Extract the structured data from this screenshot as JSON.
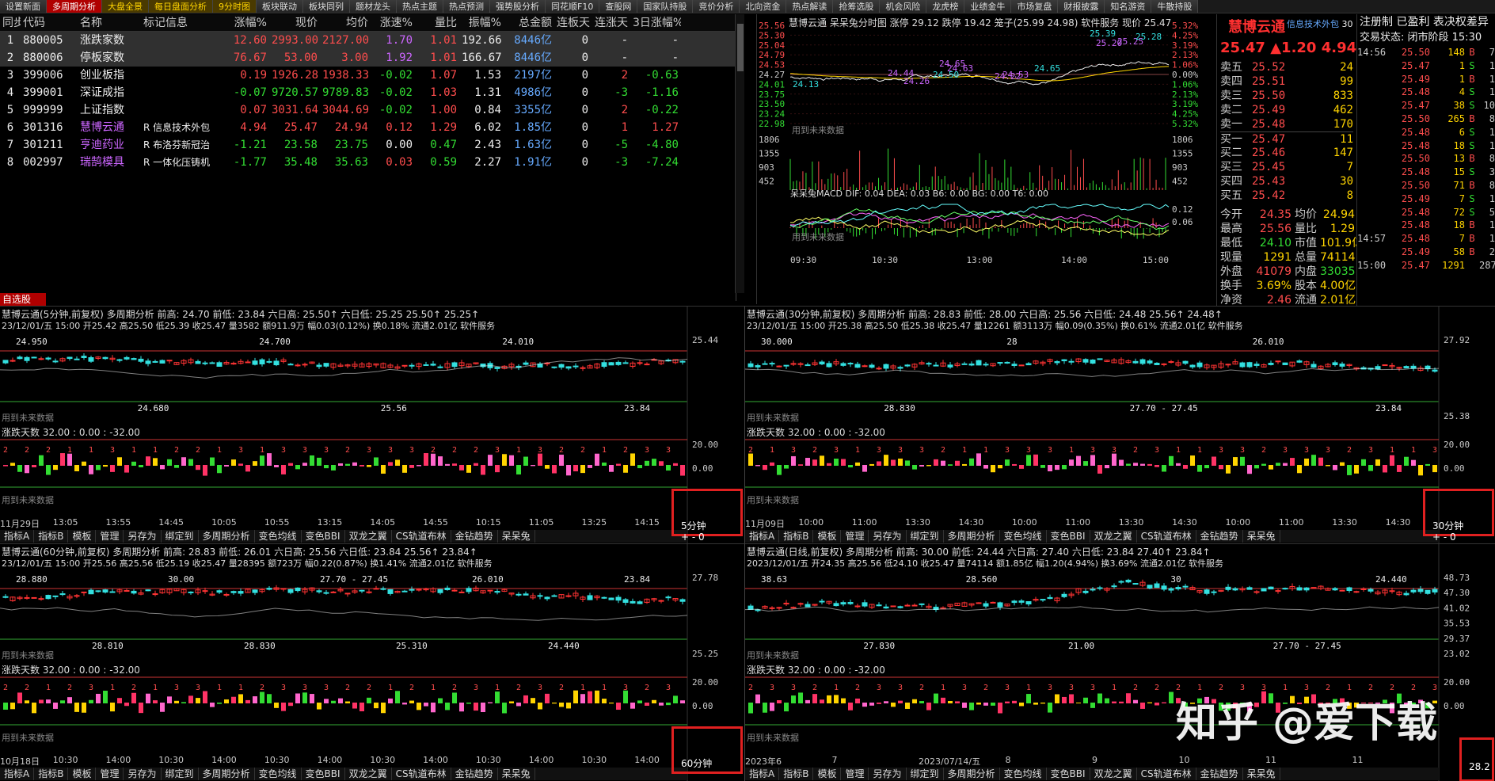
{
  "tabs": [
    "设置新面",
    "多周期分析",
    "大盘全景",
    "每日盘面分析",
    "9分时图",
    "板块联动",
    "板块同列",
    "题材龙头",
    "热点主题",
    "热点预测",
    "强势股分析",
    "同花顺F10",
    "查股网",
    "国家队持股",
    "竞价分析",
    "北向资金",
    "热点解读",
    "抢筹选股",
    "机会风险",
    "龙虎榜",
    "业绩金牛",
    "市场复盘",
    "财报披露",
    "知名游资",
    "牛散持股"
  ],
  "table": {
    "headers": [
      "同步",
      "代码",
      "名称",
      "标记信息",
      "涨幅%",
      "现价",
      "均价",
      "涨速%",
      "量比",
      "振幅%",
      "总金额",
      "连板天",
      "连涨天",
      "3日涨幅%"
    ],
    "rows": [
      {
        "i": "1",
        "code": "880005",
        "name": "涨跌家数",
        "tag": "",
        "chg": "12.60",
        "price": "2993.00",
        "avg": "2127.00",
        "spd": "1.70",
        "vr": "1.01",
        "amp": "192.66",
        "amt": "8446亿",
        "lb": "0",
        "lz": "-",
        "r3": "-"
      },
      {
        "i": "2",
        "code": "880006",
        "name": "停板家数",
        "tag": "",
        "chg": "76.67",
        "price": "53.00",
        "avg": "3.00",
        "spd": "1.92",
        "vr": "1.01",
        "amp": "166.67",
        "amt": "8446亿",
        "lb": "0",
        "lz": "-",
        "r3": "-"
      },
      {
        "i": "3",
        "code": "399006",
        "name": "创业板指",
        "tag": "",
        "chg": "0.19",
        "price": "1926.28",
        "avg": "1938.33",
        "spd": "-0.02",
        "vr": "1.07",
        "amp": "1.53",
        "amt": "2197亿",
        "lb": "0",
        "lz": "2",
        "r3": "-0.63"
      },
      {
        "i": "4",
        "code": "399001",
        "name": "深证成指",
        "tag": "",
        "chg": "-0.07",
        "price": "9720.57",
        "avg": "9789.83",
        "spd": "-0.02",
        "vr": "1.03",
        "amp": "1.31",
        "amt": "4986亿",
        "lb": "0",
        "lz": "-3",
        "r3": "-1.16"
      },
      {
        "i": "5",
        "code": "999999",
        "name": "上证指数",
        "tag": "",
        "chg": "0.07",
        "price": "3031.64",
        "avg": "3044.69",
        "spd": "-0.02",
        "vr": "1.00",
        "amp": "0.84",
        "amt": "3355亿",
        "lb": "0",
        "lz": "2",
        "r3": "-0.22"
      },
      {
        "i": "6",
        "code": "301316",
        "name": "慧博云通",
        "tag": "R 信息技术外包",
        "chg": "4.94",
        "price": "25.47",
        "avg": "24.94",
        "spd": "0.12",
        "vr": "1.29",
        "amp": "6.02",
        "amt": "1.85亿",
        "lb": "0",
        "lz": "1",
        "r3": "1.27"
      },
      {
        "i": "7",
        "code": "301211",
        "name": "亨迪药业",
        "tag": "R 布洛芬新冠治",
        "chg": "-1.21",
        "price": "23.58",
        "avg": "23.75",
        "spd": "0.00",
        "vr": "0.47",
        "amp": "2.43",
        "amt": "1.63亿",
        "lb": "0",
        "lz": "-5",
        "r3": "-4.80"
      },
      {
        "i": "8",
        "code": "002997",
        "name": "瑞鹄模具",
        "tag": "R 一体化压铸机",
        "chg": "-1.77",
        "price": "35.48",
        "avg": "35.63",
        "spd": "0.03",
        "vr": "0.59",
        "amp": "2.27",
        "amt": "1.91亿",
        "lb": "0",
        "lz": "-3",
        "r3": "-7.24"
      }
    ]
  },
  "autopick": "自选股",
  "intraday": {
    "title": "慧博云通  呆呆兔分时图  涨停 29.12 跌停 19.42 笼子(25.99 24.98) 软件服务 现价 25.47",
    "left_scale": [
      "25.56",
      "25.30",
      "25.04",
      "24.79",
      "24.53",
      "24.27",
      "24.01",
      "23.75",
      "23.50",
      "23.24",
      "22.98"
    ],
    "right_scale": [
      "5.32%",
      "4.25%",
      "3.19%",
      "2.13%",
      "1.06%",
      "0.00%",
      "1.06%",
      "2.13%",
      "3.19%",
      "4.25%",
      "5.32%"
    ],
    "vol_scale": [
      "1806",
      "1355",
      "903",
      "452"
    ],
    "macd_title": "呆呆兔MACD DIF: 0.04  DEA: 0.03  B6: 0.00  BG: 0.00  T6: 0.00",
    "macd_scale": [
      "0.12",
      "0.06"
    ],
    "future": "用到未来数据",
    "times": [
      "09:30",
      "10:30",
      "13:00",
      "14:00",
      "15:00"
    ],
    "labels": [
      "25.39",
      "25.20",
      "25.25",
      "25.28",
      "24.65",
      "24.63",
      "24.50",
      "24.44",
      "24.26",
      "24.13",
      "24.22",
      "24.53",
      "24.65"
    ]
  },
  "quote": {
    "name": "慧博云通",
    "sub": "信息技术外包",
    "sub_num": "30",
    "price": "25.47  ▲1.20 4.94%",
    "book": [
      {
        "l": "卖五",
        "p": "25.52",
        "v": "24"
      },
      {
        "l": "卖四",
        "p": "25.51",
        "v": "99"
      },
      {
        "l": "卖三",
        "p": "25.50",
        "v": "833"
      },
      {
        "l": "卖二",
        "p": "25.49",
        "v": "462"
      },
      {
        "l": "卖一",
        "p": "25.48",
        "v": "170"
      },
      {
        "l": "买一",
        "p": "25.47",
        "v": "11"
      },
      {
        "l": "买二",
        "p": "25.46",
        "v": "147"
      },
      {
        "l": "买三",
        "p": "25.45",
        "v": "7"
      },
      {
        "l": "买四",
        "p": "25.43",
        "v": "30"
      },
      {
        "l": "买五",
        "p": "25.42",
        "v": "8"
      }
    ],
    "stats": [
      {
        "a": "今开",
        "b": "24.35",
        "c": "均价",
        "d": "24.94"
      },
      {
        "a": "最高",
        "b": "25.56",
        "c": "量比",
        "d": "1.29"
      },
      {
        "a": "最低",
        "b": "24.10",
        "c": "市值",
        "d": "101.9亿"
      },
      {
        "a": "现量",
        "b": "1291",
        "c": "总量",
        "d": "74114"
      },
      {
        "a": "外盘",
        "b": "41079",
        "c": "内盘",
        "d": "33035"
      },
      {
        "a": "换手",
        "b": "3.69%",
        "c": "股本",
        "d": "4.00亿"
      },
      {
        "a": "净资",
        "b": "2.46",
        "c": "流通",
        "d": "2.01亿"
      }
    ]
  },
  "ticks": {
    "hdr1": "注册制 已盈利 表决权差异",
    "hdr2": "交易状态: 闭市阶段 15:30",
    "rows": [
      {
        "t": "14:56",
        "p": "25.50",
        "v": "148",
        "s": "B",
        "n": "7"
      },
      {
        "t": "",
        "p": "25.47",
        "v": "1",
        "s": "S",
        "n": "1"
      },
      {
        "t": "",
        "p": "25.49",
        "v": "1",
        "s": "B",
        "n": "1"
      },
      {
        "t": "",
        "p": "25.48",
        "v": "4",
        "s": "S",
        "n": "1"
      },
      {
        "t": "",
        "p": "25.47",
        "v": "38",
        "s": "S",
        "n": "10"
      },
      {
        "t": "",
        "p": "25.50",
        "v": "265",
        "s": "B",
        "n": "8"
      },
      {
        "t": "",
        "p": "25.48",
        "v": "6",
        "s": "S",
        "n": "1"
      },
      {
        "t": "",
        "p": "25.48",
        "v": "18",
        "s": "S",
        "n": "1"
      },
      {
        "t": "",
        "p": "25.50",
        "v": "13",
        "s": "B",
        "n": "8"
      },
      {
        "t": "",
        "p": "25.48",
        "v": "15",
        "s": "S",
        "n": "3"
      },
      {
        "t": "",
        "p": "25.50",
        "v": "71",
        "s": "B",
        "n": "8"
      },
      {
        "t": "",
        "p": "25.49",
        "v": "7",
        "s": "S",
        "n": "1"
      },
      {
        "t": "",
        "p": "25.48",
        "v": "72",
        "s": "S",
        "n": "5"
      },
      {
        "t": "",
        "p": "25.48",
        "v": "18",
        "s": "B",
        "n": "1"
      },
      {
        "t": "14:57",
        "p": "25.48",
        "v": "7",
        "s": "B",
        "n": "1"
      },
      {
        "t": "",
        "p": "25.49",
        "v": "58",
        "s": "B",
        "n": "2"
      },
      {
        "t": "15:00",
        "p": "25.47",
        "v": "1291",
        "s": "",
        "n": "287"
      }
    ]
  },
  "panels": [
    {
      "title": "慧博云通(5分钟,前复权)  多周期分析 前高: 24.70 前低: 23.84 六日高: 25.50↑ 六日低: 25.25 25.50↑ 25.25↑",
      "info": "23/12/01/五 15:00 开25.42 高25.50 低25.39 收25.47 量3582 额911.9万 幅0.03(0.12%) 换0.18% 流通2.01亿 软件服务",
      "scale": [
        "25.44"
      ],
      "labels": [
        "24.950",
        "24.680",
        "24.700",
        "25.56",
        "24.010",
        "23.84"
      ],
      "ind": "涨跌天数 32.00 : 0.00 : -32.00",
      "ind_scale": [
        "20.00",
        "0.00"
      ],
      "times": [
        "11月29日",
        "13:05",
        "13:55",
        "14:45",
        "10:05",
        "10:55",
        "13:15",
        "14:05",
        "14:55",
        "10:15",
        "11:05",
        "13:25",
        "14:15"
      ],
      "period": "5分钟",
      "future": "用到未来数据"
    },
    {
      "title": "慧博云通(30分钟,前复权)  多周期分析 前高: 28.83 前低: 28.00 六日高: 25.56 六日低: 24.48 25.56↑ 24.48↑",
      "info": "23/12/01/五 15:00 开25.38 高25.50 低25.38 收25.47 量12261 额3113万 幅0.09(0.35%) 换0.61% 流通2.01亿 软件服务",
      "scale": [
        "27.92",
        "25.38"
      ],
      "labels": [
        "30.000",
        "28.830",
        "28",
        "27.70 - 27.45",
        "26.010",
        "23.84"
      ],
      "ind": "涨跌天数 32.00 : 0.00 : -32.00",
      "ind_scale": [
        "20.00",
        "0.00"
      ],
      "times": [
        "11月09日",
        "10:00",
        "11:00",
        "13:30",
        "14:30",
        "10:00",
        "11:00",
        "13:30",
        "14:30",
        "10:00",
        "11:00",
        "13:30",
        "14:30"
      ],
      "period": "30分钟",
      "future": "用到未来数据"
    },
    {
      "title": "慧博云通(60分钟,前复权)  多周期分析 前高: 28.83 前低: 26.01 六日高: 25.56 六日低: 23.84 25.56↑ 23.84↑",
      "info": "23/12/01/五 15:00 开25.56 高25.56 低25.19 收25.47 量28395 额723万 幅0.22(0.87%) 换1.41% 流通2.01亿 软件服务",
      "scale": [
        "27.78",
        "25.25"
      ],
      "labels": [
        "28.880",
        "28.810",
        "30.00",
        "28.830",
        "27.70 - 27.45",
        "25.310",
        "26.010",
        "24.440",
        "23.84"
      ],
      "ind": "涨跌天数 32.00 : 0.00 : -32.00",
      "ind_scale": [
        "20.00",
        "0.00"
      ],
      "times": [
        "10月18日",
        "10:30",
        "14:00",
        "10:30",
        "14:00",
        "10:30",
        "14:00",
        "10:30",
        "14:00",
        "10:30",
        "14:00",
        "10:30",
        "14:00"
      ],
      "period": "60分钟",
      "future": "用到未来数据"
    },
    {
      "title": "慧博云通(日线,前复权)  多周期分析 前高: 30.00 前低: 24.44 六日高: 27.40 六日低: 23.84 27.40↑ 23.84↑",
      "info": "2023/12/01/五 开24.35 高25.56 低24.10 收25.47 量74114 额1.85亿 幅1.20(4.94%) 换3.69% 流通2.01亿 软件服务",
      "scale": [
        "48.73",
        "47.30",
        "41.02",
        "35.53",
        "29.37",
        "23.02"
      ],
      "labels": [
        "38.63",
        "27.830",
        "28.560",
        "21.00",
        "30",
        "27.70 - 27.45",
        "24.440"
      ],
      "ind": "涨跌天数 32.00 : 0.00 : -32.00",
      "ind_scale": [
        "20.00",
        "0.00"
      ],
      "times": [
        "2023年6",
        "7",
        "2023/07/14/五",
        "8",
        "9",
        "10",
        "11",
        "11"
      ],
      "period": "28.2",
      "future": "用到未来数据"
    }
  ],
  "toolbar": [
    "指标A",
    "指标B",
    "模板",
    "管理",
    "另存为",
    "绑定到",
    "多周期分析",
    "变色均线",
    "变色BBI",
    "双龙之翼",
    "CS轨道布林",
    "金钻趋势",
    "呆呆兔"
  ],
  "watermark": "知乎 @爱下载",
  "colors": {
    "up": "#ff4d4d",
    "down": "#33dd33",
    "tab_active": "#b00000",
    "box": "#e02020"
  }
}
